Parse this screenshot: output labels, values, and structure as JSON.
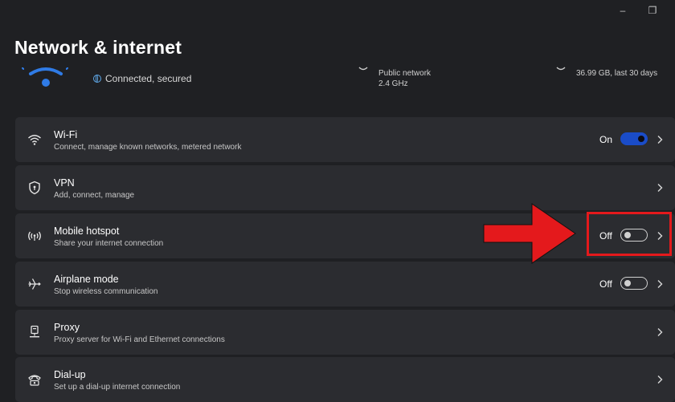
{
  "window": {
    "minimize_glyph": "–",
    "restore_glyph": "❐"
  },
  "header": {
    "title": "Network & internet"
  },
  "status": {
    "connection": "Connected, secured",
    "network_type": "Public network",
    "band": "2.4 GHz",
    "data_usage": "36.99 GB, last 30 days"
  },
  "settings": [
    {
      "title": "Wi-Fi",
      "subtitle": "Connect, manage known networks, metered network",
      "state": "On",
      "icon": "wifi-icon"
    },
    {
      "title": "VPN",
      "subtitle": "Add, connect, manage",
      "icon": "shield-icon"
    },
    {
      "title": "Mobile hotspot",
      "subtitle": "Share your internet connection",
      "state": "Off",
      "icon": "hotspot-icon"
    },
    {
      "title": "Airplane mode",
      "subtitle": "Stop wireless communication",
      "state": "Off",
      "icon": "airplane-icon"
    },
    {
      "title": "Proxy",
      "subtitle": "Proxy server for Wi-Fi and Ethernet connections",
      "icon": "proxy-icon"
    },
    {
      "title": "Dial-up",
      "subtitle": "Set up a dial-up internet connection",
      "icon": "dialup-icon"
    }
  ],
  "colors": {
    "toggle_on": "#1a4cc8",
    "annotation_red": "#e4191c",
    "row_bg": "#2b2c30",
    "accent_wifi": "#2f7be6"
  }
}
